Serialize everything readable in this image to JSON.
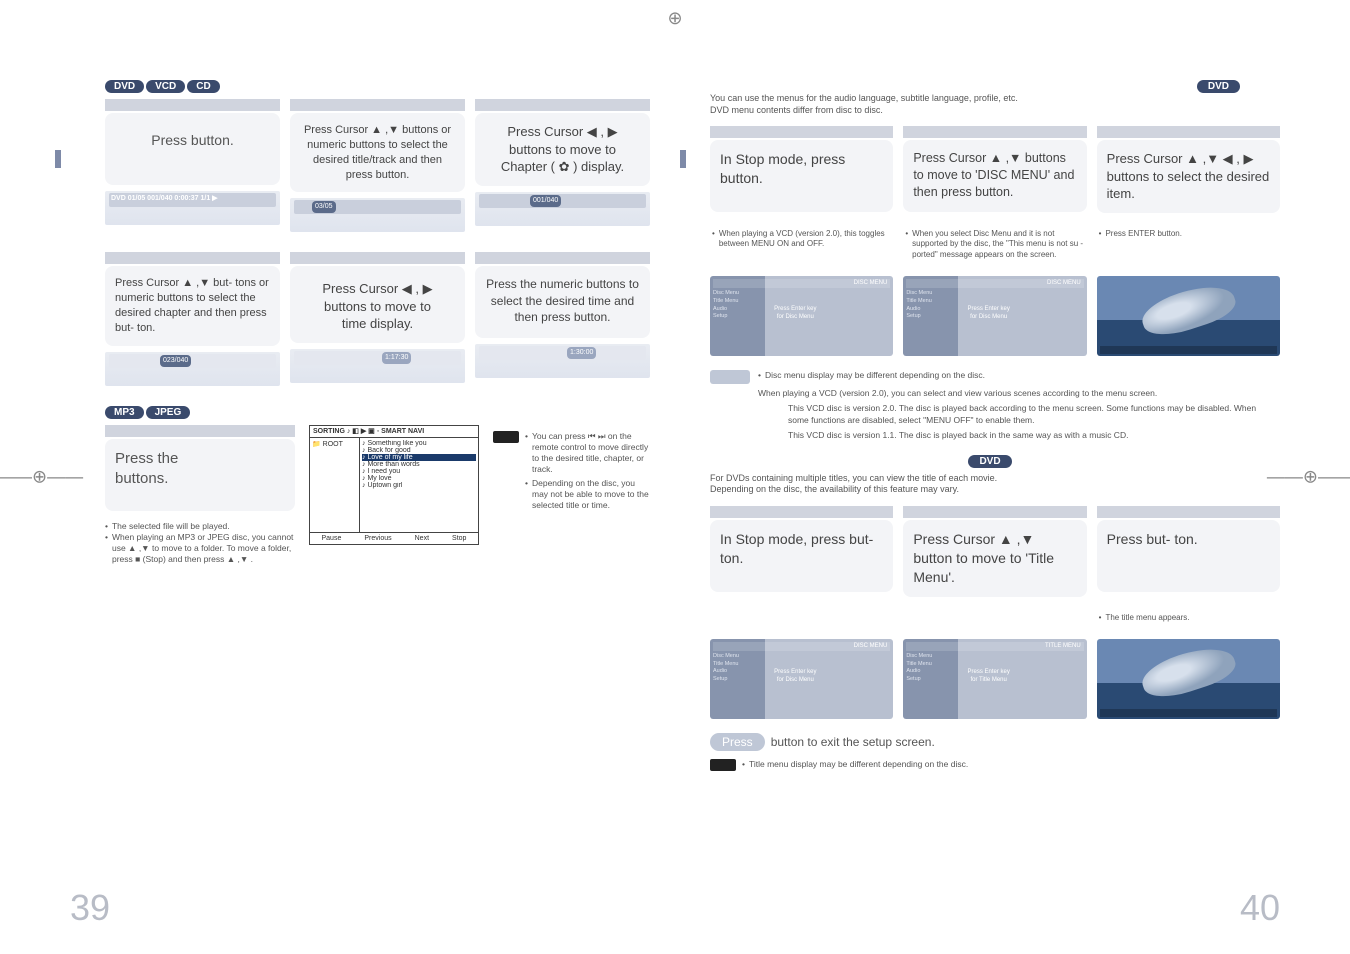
{
  "crop": {
    "top": "⊕",
    "left": "——⊕——",
    "right": "——⊕——"
  },
  "pageLeftNum": "39",
  "pageRightNum": "40",
  "leftBadges": [
    "DVD",
    "VCD",
    "CD"
  ],
  "leftBadges2": [
    "MP3",
    "JPEG"
  ],
  "dvdBadge": "DVD",
  "grid1": {
    "c1": {
      "title": "Press            button."
    },
    "c2": {
      "text": "Press Cursor ▲ ,▼ buttons or numeric buttons to select the desired title/track and then press        button."
    },
    "c3": {
      "line1": "Press Cursor ◀ , ▶",
      "line2": "buttons to move to",
      "line3": "Chapter ( ✿ ) display."
    }
  },
  "osd1": {
    "a": "DVD  01/05  001/040  0:00:37  1/1 ▶",
    "b": "03/05",
    "c": "001/040"
  },
  "grid2": {
    "c1": {
      "text": "Press Cursor ▲ ,▼ but- tons or numeric buttons to select the desired chapter and then press        but- ton."
    },
    "c2": {
      "line1": "Press Cursor ◀ , ▶",
      "line2": "buttons to move to",
      "line3": "time display."
    },
    "c3": {
      "text": "Press the numeric buttons to select the desired time and then press          button."
    }
  },
  "osd2": {
    "a": "023/040",
    "b": "1:17:30",
    "c": "1:30:00"
  },
  "mp3Box": {
    "title": "Press the",
    "title2": "buttons."
  },
  "mp3Notes": {
    "n1": "The selected file will be played.",
    "n2": "When playing an MP3 or JPEG disc, you cannot use ▲ ,▼ to move to a folder. To move a folder, press ■ (Stop) and then press ▲ ,▼ ."
  },
  "noteBox": {
    "n1": "You can press ⏮ ⏭ on the remote control to move directly to the desired title, chapter, or track.",
    "n2": "Depending on the disc, you may not be able to move to the selected title or time."
  },
  "fb": {
    "header": "SORTING  ♪  ◧  ▶  ▣  ◦ SMART NAVI",
    "root": "ROOT",
    "files": [
      "Something like you",
      "Back for good",
      "Love of my life",
      "More than words",
      "I need you",
      "My love",
      "Uptown girl"
    ],
    "bottom": [
      "Pause",
      "Previous",
      "Next",
      "Stop"
    ]
  },
  "rIntro1": "You can use the menus for the audio language, subtitle language, profile, etc.\nDVD menu contents differ from disc to disc.",
  "r1": {
    "c1": "In Stop mode, press button.",
    "c2": "Press Cursor ▲ ,▼ buttons to move to 'DISC MENU' and then press        button.",
    "c3": "Press Cursor ▲ ,▼ ◀ , ▶ buttons to select the desired item."
  },
  "rN1": {
    "a": "When playing a VCD (version 2.0), this toggles between MENU ON and OFF.",
    "b": "When you select Disc Menu and it is not supported by the disc, the \"This menu is not su   - ported\" message appears on the screen.",
    "c": "Press ENTER button."
  },
  "thumbLabel": "DISC MENU",
  "thumbLabel2": "TITLE MENU",
  "thumbCenter": "Press Enter key\nfor Disc Menu",
  "thumbCenter2": "Press Enter key\nfor Title Menu",
  "thumbSide": "Disc Menu\nTitle Menu\nAudio\nSetup",
  "note1": {
    "a": "Disc menu display may be different depending on the disc.",
    "b": "When playing a VCD (version 2.0), you can select and view various scenes according to the menu screen.",
    "c": "This VCD disc is version 2.0. The disc is played back according to the menu screen. Some functions may be disabled. When some functions are disabled, select \"MENU OFF\" to enable them.",
    "d": "This VCD disc is version 1.1. The disc is played back in the same way as with a music CD."
  },
  "rIntro2": "For DVDs containing multiple titles, you can view the title of each movie.\nDepending on the disc, the availability of this feature may vary.",
  "r2": {
    "c1": "In Stop mode, press          but- ton.",
    "c2": "Press Cursor ▲ ,▼ button to move to 'Title Menu'.",
    "c3": "Press            but- ton."
  },
  "r2n": "The title menu appears.",
  "exit": "Press           button to exit the setup screen.",
  "bottomNote": "Title menu display may be different depending on the disc."
}
